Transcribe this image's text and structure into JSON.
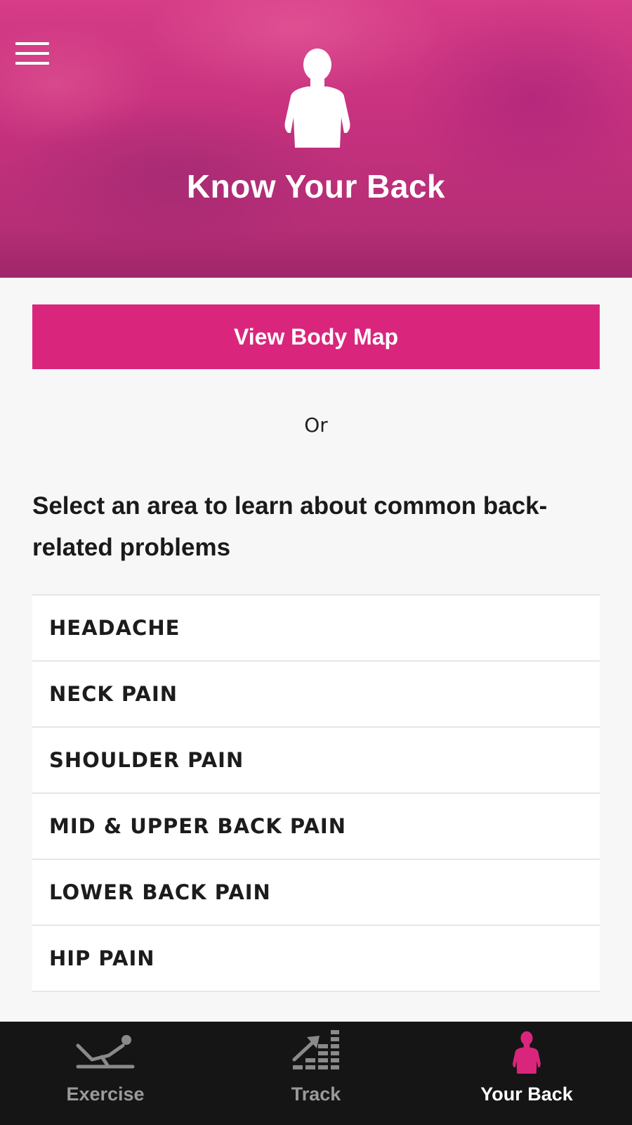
{
  "header": {
    "menu_icon": "hamburger-menu-icon",
    "hero_icon": "person-torso-icon",
    "title": "Know Your Back"
  },
  "main": {
    "body_map_button": "View Body Map",
    "or_text": "Or",
    "intro_text": "Select an area to learn about common back-related problems",
    "areas": [
      {
        "label": "HEADACHE"
      },
      {
        "label": "NECK PAIN"
      },
      {
        "label": "SHOULDER PAIN"
      },
      {
        "label": "MID & UPPER BACK PAIN"
      },
      {
        "label": "LOWER BACK PAIN"
      },
      {
        "label": "HIP PAIN"
      }
    ]
  },
  "tabbar": {
    "tabs": [
      {
        "label": "Exercise",
        "icon": "exercise-icon",
        "active": false
      },
      {
        "label": "Track",
        "icon": "track-chart-icon",
        "active": false
      },
      {
        "label": "Your Back",
        "icon": "person-torso-icon",
        "active": true
      }
    ]
  },
  "colors": {
    "accent": "#d9267c",
    "header_base": "#c6317e",
    "tabbar_bg": "#151515",
    "tab_inactive": "#9a9a9a",
    "tab_active_label": "#ffffff"
  }
}
